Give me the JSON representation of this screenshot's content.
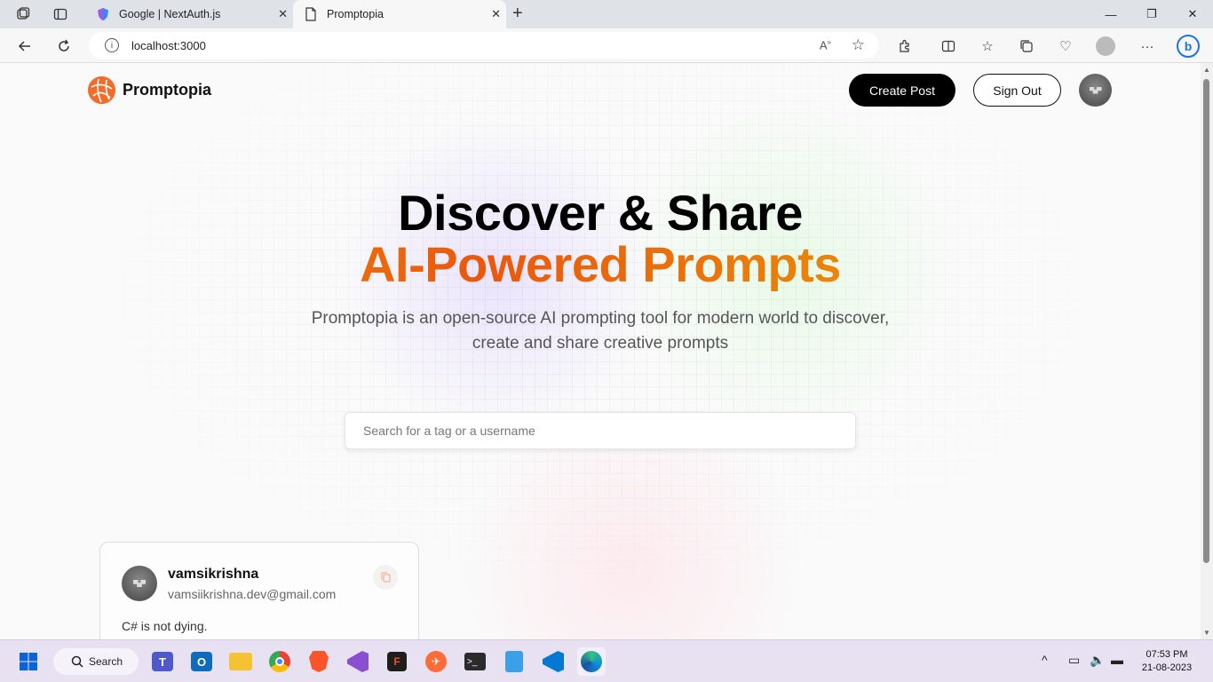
{
  "browser": {
    "tabs": [
      {
        "title": "Google | NextAuth.js",
        "active": false
      },
      {
        "title": "Promptopia",
        "active": true
      }
    ],
    "url": "localhost:3000"
  },
  "nav": {
    "brand": "Promptopia",
    "create_label": "Create Post",
    "signout_label": "Sign Out"
  },
  "hero": {
    "title_line1": "Discover & Share",
    "title_line2": "AI-Powered Prompts",
    "description": "Promptopia is an open-source AI prompting tool for modern world to discover, create and share creative prompts"
  },
  "search": {
    "placeholder": "Search for a tag or a username",
    "value": ""
  },
  "feed": [
    {
      "username": "vamsikrishna",
      "email": "vamsiikrishna.dev@gmail.com",
      "prompt": "C# is not dying."
    }
  ],
  "taskbar": {
    "search_label": "Search",
    "time": "07:53 PM",
    "date": "21-08-2023"
  },
  "colors": {
    "accent_orange": "#ea580c",
    "gradient_start": "#f59e0b",
    "gradient_end": "#eab308",
    "button_black": "#000000"
  }
}
